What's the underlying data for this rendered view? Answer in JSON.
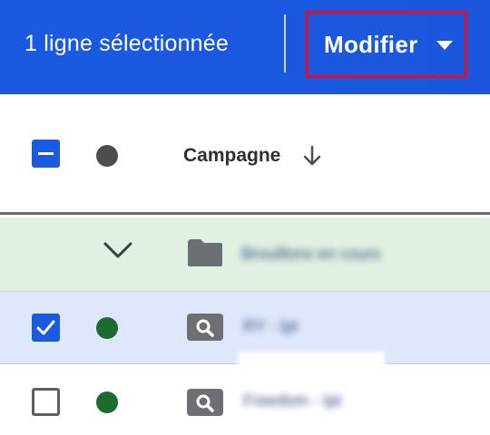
{
  "selection_bar": {
    "count_text": "1 ligne sélectionnée",
    "modify_label": "Modifier",
    "caret_icon": "caret-down-icon",
    "background": "#1a5ae0",
    "highlight_border": "#e0102a"
  },
  "table_header": {
    "select_all_state": "indeterminate",
    "status_icon": "status-dot-icon",
    "column_title": "Campagne",
    "sort_icon": "arrow-down-icon"
  },
  "group_row": {
    "expand_icon": "chevron-down-icon",
    "folder_icon": "folder-icon",
    "label_blurred": "Brouillons en cours",
    "background": "#e0f1e2"
  },
  "rows": [
    {
      "checked": true,
      "status_color": "#1d6b2f",
      "type_icon": "search-campaign-icon",
      "name_blurred": "RY - Ipt"
    },
    {
      "checked": false,
      "status_color": "#1d6b2f",
      "type_icon": "search-campaign-icon",
      "name_blurred": "Freedom - Ipt"
    }
  ]
}
